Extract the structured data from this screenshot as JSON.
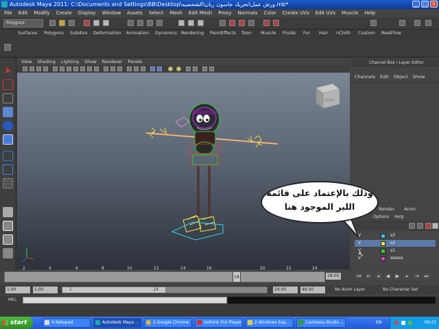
{
  "window": {
    "title": "Autodesk Maya 2011: C:\\Documents and Settings\\BB\\Desktop\\ورش عمل\\تحريك جاسون ريان\\الشخصيه.mb*",
    "controls": [
      "_",
      "□",
      "×"
    ]
  },
  "menubar": [
    "File",
    "Edit",
    "Modify",
    "Create",
    "Display",
    "Window",
    "Assets",
    "Select",
    "Mesh",
    "Edit Mesh",
    "Proxy",
    "Normals",
    "Color",
    "Create UVs",
    "Edit UVs",
    "Muscle",
    "Help"
  ],
  "status_line": {
    "mode": "Polygons"
  },
  "shelf_tabs": [
    "Surfaces",
    "Polygons",
    "Subdivs",
    "Deformation",
    "Animation",
    "Dynamics",
    "Rendering",
    "PaintEffects",
    "Toon",
    "Muscle",
    "Fluids",
    "Fur",
    "Hair",
    "nCloth",
    "Custom",
    "RealFlow"
  ],
  "viewport": {
    "menu": [
      "View",
      "Shading",
      "Lighting",
      "Show",
      "Renderer",
      "Panels"
    ],
    "viewcube_label": "FRONT"
  },
  "channel_box": {
    "title": "Channel Box / Layer Editor",
    "menu": [
      "Channels",
      "Edit",
      "Object",
      "Show"
    ]
  },
  "layer_editor": {
    "tabs": [
      "Render",
      "Anim"
    ],
    "menu": [
      "Options",
      "Help"
    ],
    "layers": [
      {
        "visible": "V",
        "name": "s3",
        "color": "#3cc0f0"
      },
      {
        "visible": "V",
        "name": "s2",
        "color": "#e8e832"
      },
      {
        "visible": "V",
        "name": "s1",
        "color": "#32d032"
      },
      {
        "visible": "V",
        "name": "ssssss",
        "color": "#e040c0"
      }
    ]
  },
  "speech_bubble": {
    "line1": "وذلك بالإعتماد على قائمة",
    "line2": "اللير الموجود هنا"
  },
  "timeline": {
    "ticks": [
      "2",
      "4",
      "6",
      "8",
      "10",
      "12",
      "14",
      "16",
      "18",
      "20",
      "22",
      "24"
    ],
    "current_frame": "18",
    "current_field": "18.00"
  },
  "range": {
    "start": "1.00",
    "anim_start": "1.00",
    "range_start": "1",
    "range_end": "24",
    "end": "24.00",
    "anim_end": "48.00",
    "anim_layer": "No Anim Layer",
    "char_set": "No Character Set"
  },
  "command_line": {
    "label": "MEL"
  },
  "taskbar": {
    "start": "start",
    "items": [
      "4 Notepad",
      "Autodesk Maya ...",
      "2 Google Chrome",
      "Sothink FLV Player",
      "2 Windows Exp...",
      "Camtasia Studio ..."
    ],
    "language": "EN",
    "time": "09:23"
  }
}
